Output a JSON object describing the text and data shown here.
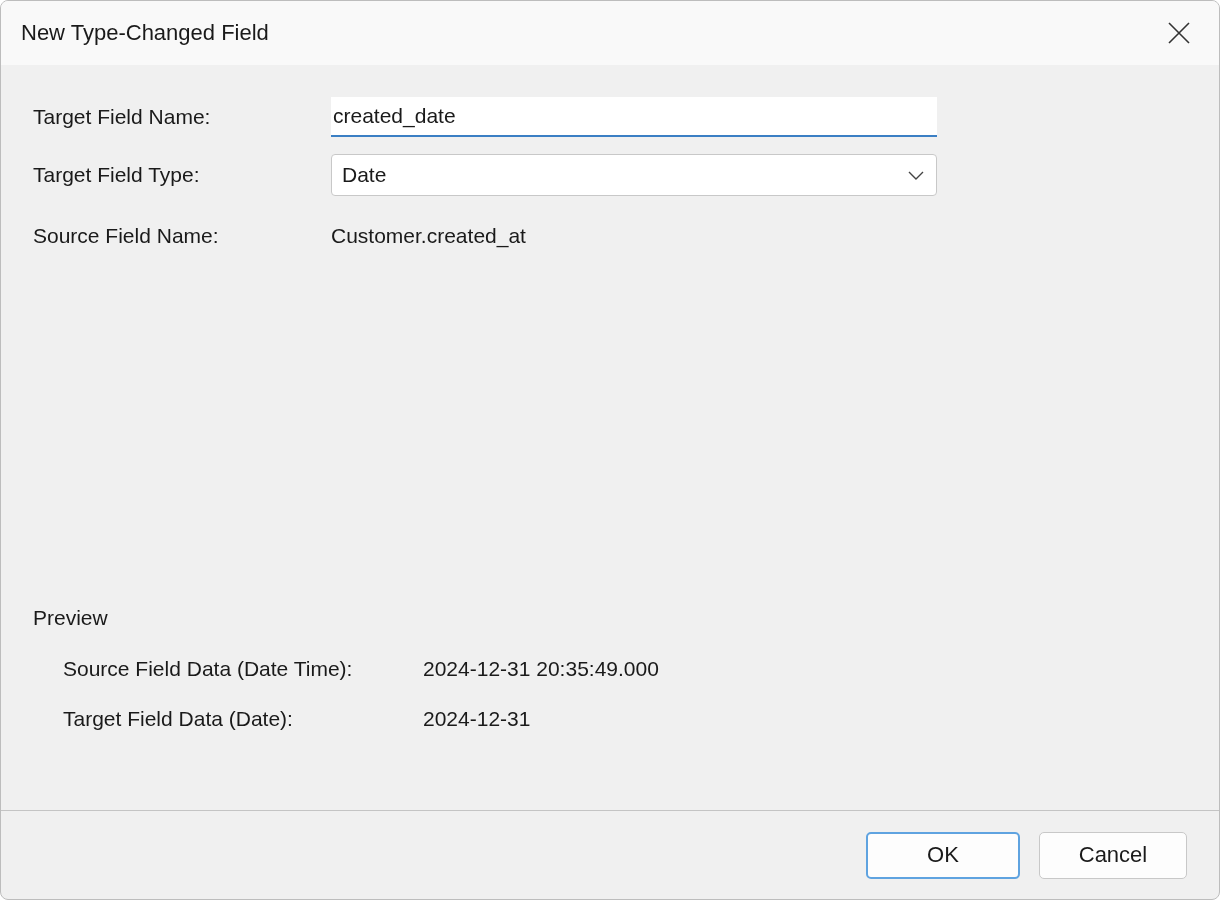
{
  "window": {
    "title": "New Type-Changed Field"
  },
  "form": {
    "target_name": {
      "label": "Target Field Name:",
      "value": "created_date"
    },
    "target_type": {
      "label": "Target Field Type:",
      "value": "Date"
    },
    "source_name": {
      "label": "Source Field Name:",
      "value": "Customer.created_at"
    }
  },
  "preview": {
    "title": "Preview",
    "rows": [
      {
        "label": "Source Field Data (Date Time):",
        "value": "2024-12-31 20:35:49.000"
      },
      {
        "label": "Target Field Data (Date):",
        "value": "2024-12-31"
      }
    ]
  },
  "buttons": [
    {
      "label": "OK",
      "default": true
    },
    {
      "label": "Cancel",
      "default": false
    }
  ]
}
